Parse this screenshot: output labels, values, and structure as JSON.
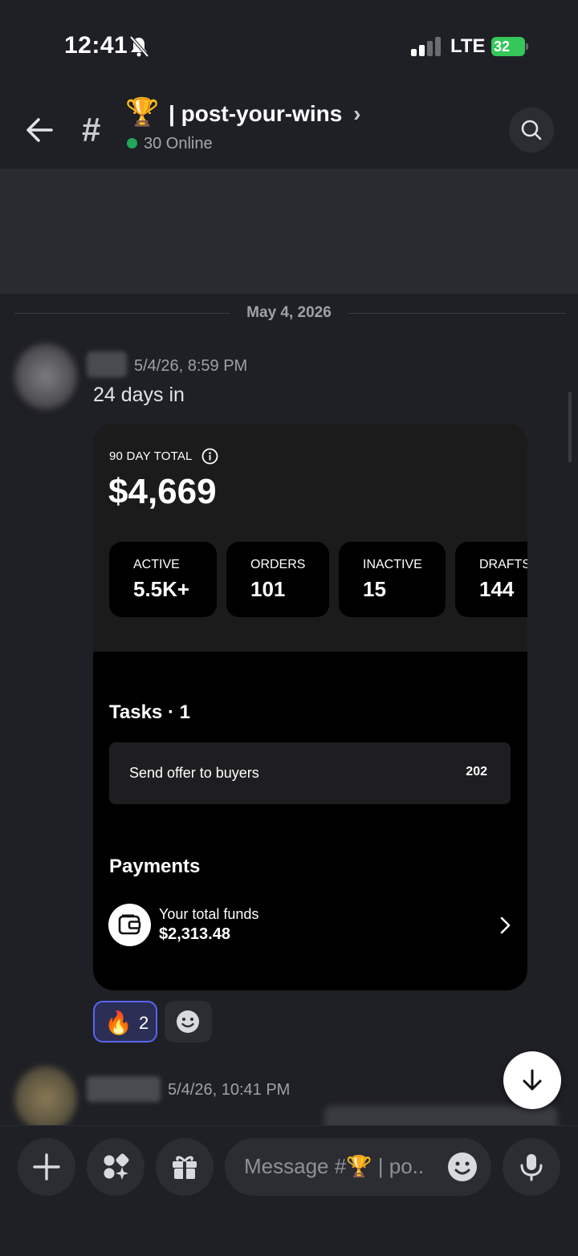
{
  "status_bar": {
    "time": "12:41",
    "network": "LTE",
    "battery": "32"
  },
  "header": {
    "channel_emoji": "🏆",
    "channel_name": "| post-your-wins",
    "chevron": "›",
    "online": "30 Online"
  },
  "date_divider": "May 4, 2026",
  "messages": [
    {
      "timestamp": "5/4/26, 8:59 PM",
      "text": "24 days in",
      "card": {
        "total_label": "90 DAY TOTAL",
        "total_value": "$4,669",
        "stats": [
          {
            "label": "ACTIVE",
            "value": "5.5K+"
          },
          {
            "label": "ORDERS",
            "value": "101"
          },
          {
            "label": "INACTIVE",
            "value": "15"
          },
          {
            "label": "DRAFTS",
            "value": "144"
          }
        ],
        "tasks_title": "Tasks · 1",
        "task": {
          "label": "Send offer to buyers",
          "count": "202"
        },
        "payments_title": "Payments",
        "funds_label": "Your total funds",
        "funds_value": "$2,313.48"
      },
      "reaction": {
        "emoji": "🔥",
        "count": "2"
      }
    },
    {
      "timestamp": "5/4/26, 10:41 PM"
    }
  ],
  "composer": {
    "placeholder": "Message #🏆 | po.."
  }
}
